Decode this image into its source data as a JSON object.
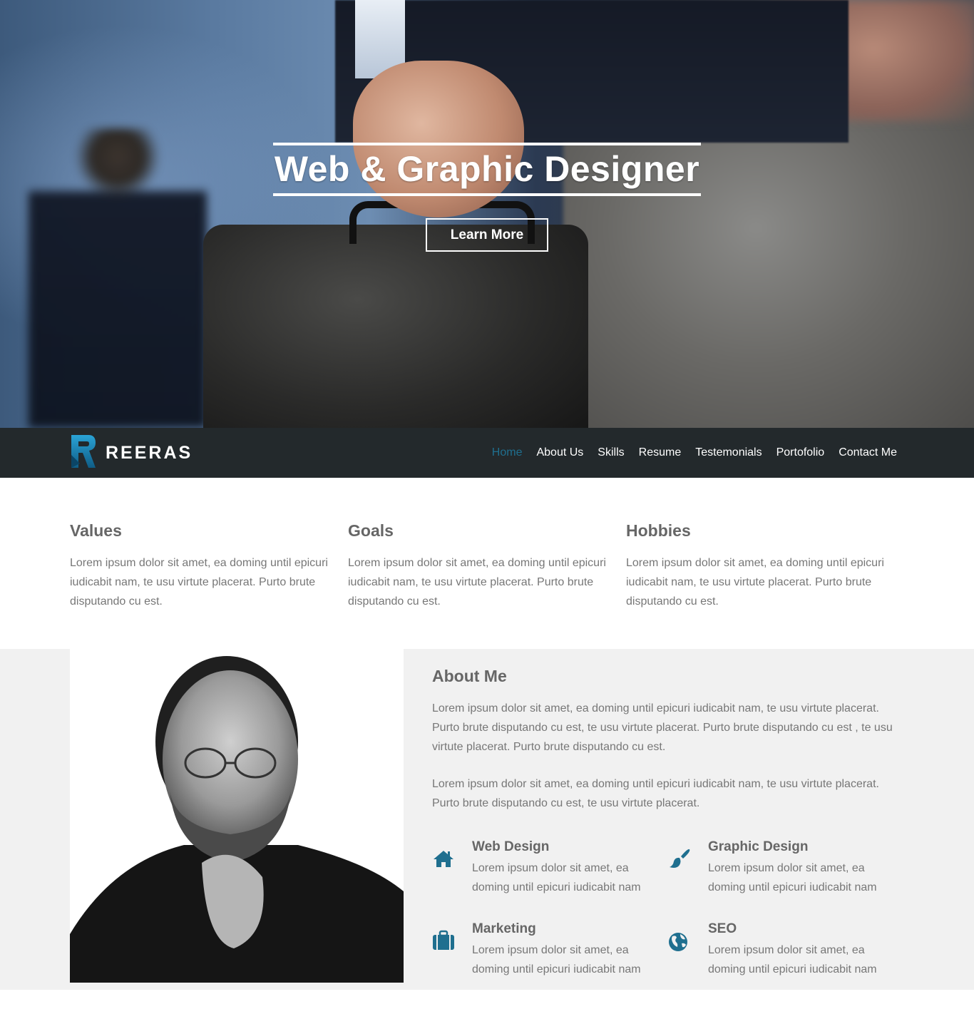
{
  "hero": {
    "title": "Web & Graphic Designer",
    "button_label": "Learn More"
  },
  "nav": {
    "brand": "REERAS",
    "items": [
      {
        "label": "Home",
        "active": true
      },
      {
        "label": "About Us",
        "active": false
      },
      {
        "label": "Skills",
        "active": false
      },
      {
        "label": "Resume",
        "active": false
      },
      {
        "label": "Testemonials",
        "active": false
      },
      {
        "label": "Portofolio",
        "active": false
      },
      {
        "label": "Contact Me",
        "active": false
      }
    ]
  },
  "columns": [
    {
      "title": "Values",
      "text": "Lorem ipsum dolor sit amet, ea doming until epicuri iudicabit nam, te usu virtute placerat. Purto brute disputando cu est."
    },
    {
      "title": "Goals",
      "text": "Lorem ipsum dolor sit amet, ea doming until epicuri iudicabit nam, te usu virtute placerat. Purto brute disputando cu est."
    },
    {
      "title": "Hobbies",
      "text": "Lorem ipsum dolor sit amet, ea doming until epicuri iudicabit nam, te usu virtute placerat. Purto brute disputando cu est."
    }
  ],
  "about": {
    "title": "About Me",
    "paragraph1": "Lorem ipsum dolor sit amet, ea doming until epicuri iudicabit nam, te usu virtute placerat. Purto brute disputando cu est, te usu virtute placerat. Purto brute disputando cu est , te usu virtute placerat. Purto brute disputando cu est.",
    "paragraph2": "Lorem ipsum dolor sit amet, ea doming until epicuri iudicabit nam, te usu virtute placerat. Purto brute disputando cu est, te usu virtute placerat.",
    "features": [
      {
        "title": "Web Design",
        "text": "Lorem ipsum dolor sit amet, ea doming until epicuri iudicabit nam",
        "icon": "home-icon"
      },
      {
        "title": "Graphic Design",
        "text": "Lorem ipsum dolor sit amet, ea doming until epicuri iudicabit nam",
        "icon": "paintbrush-icon"
      },
      {
        "title": "Marketing",
        "text": "Lorem ipsum dolor sit amet, ea doming until epicuri iudicabit nam",
        "icon": "briefcase-icon"
      },
      {
        "title": "SEO",
        "text": "Lorem ipsum dolor sit amet, ea doming until epicuri iudicabit nam",
        "icon": "globe-icon"
      }
    ]
  },
  "colors": {
    "accent": "#1f6f8f",
    "nav_bg": "#23292c",
    "section_bg": "#f1f1f1",
    "heading": "#666666",
    "body_text": "#777777"
  }
}
